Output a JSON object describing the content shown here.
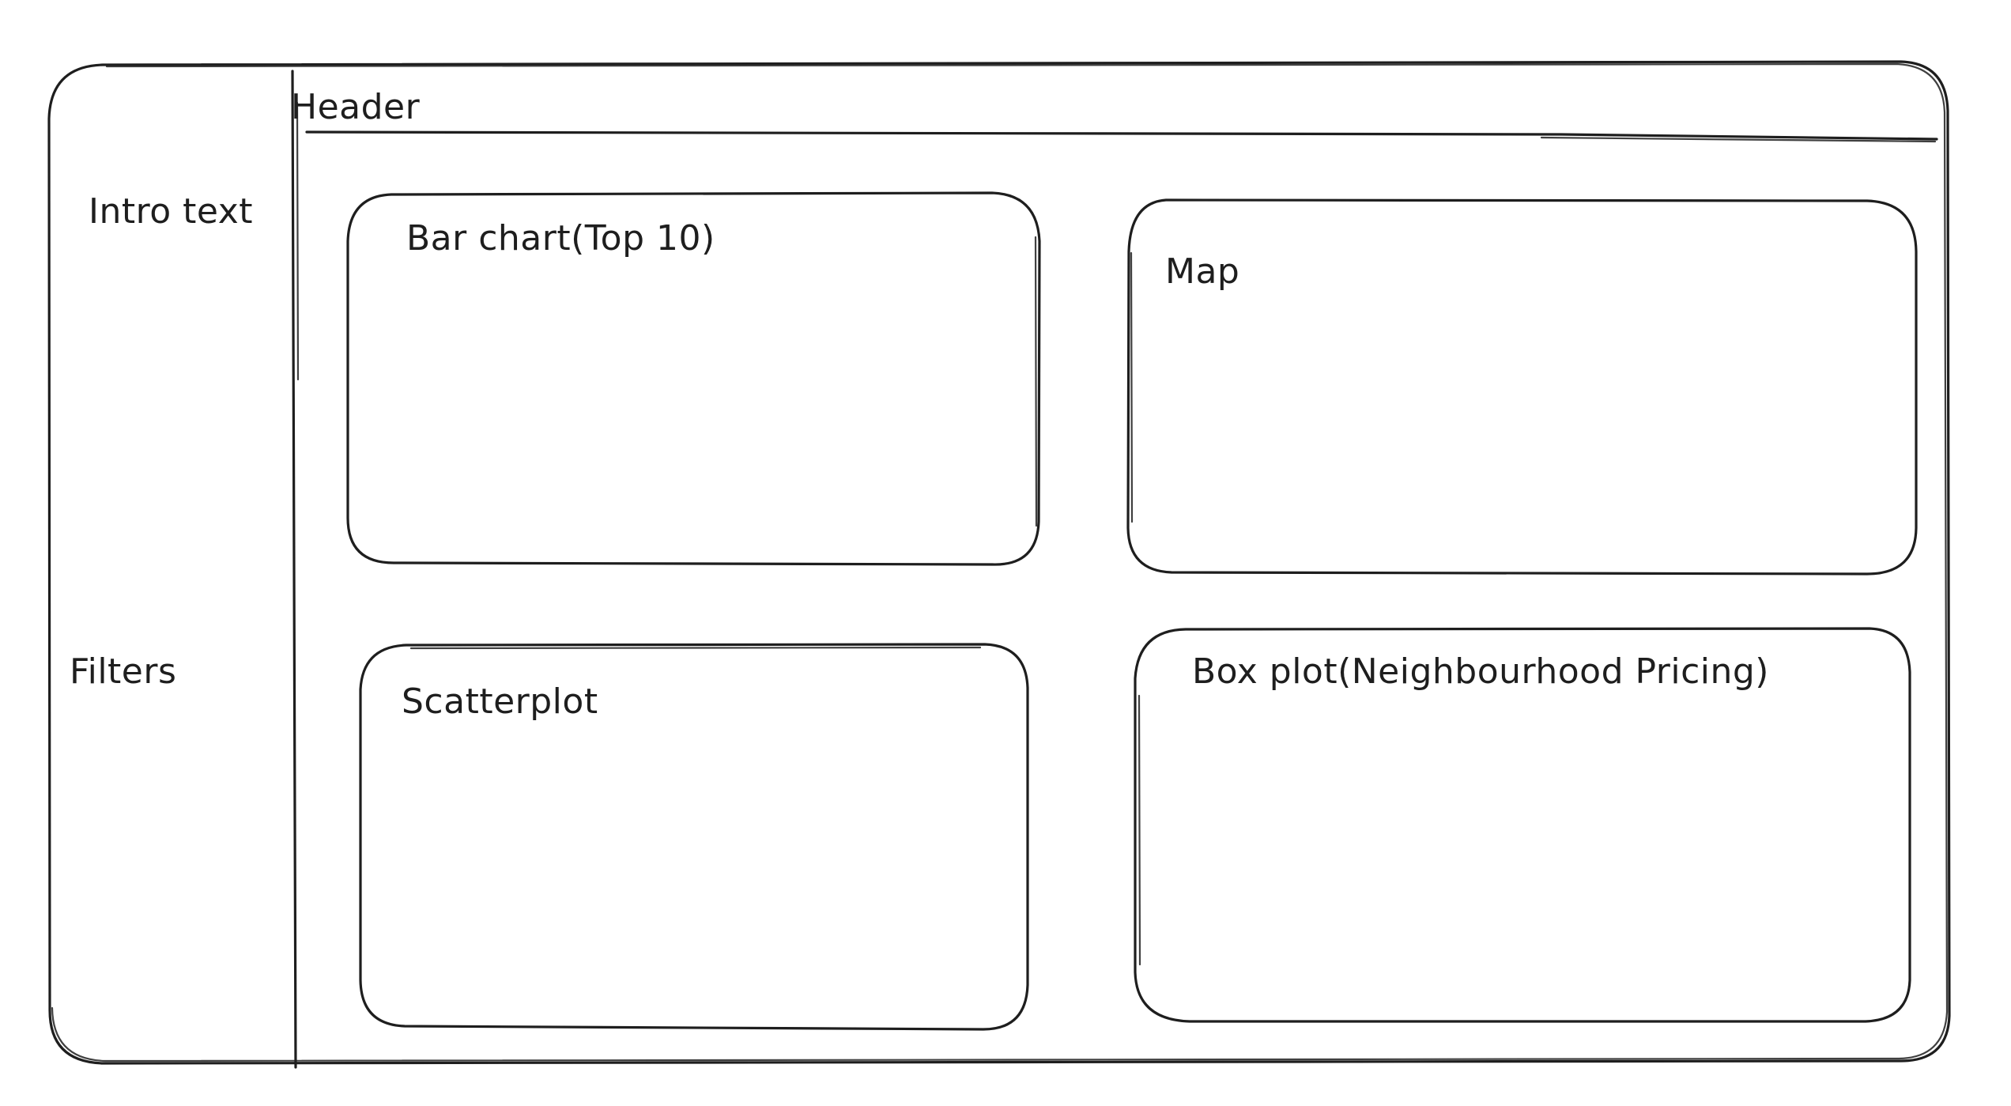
{
  "sidebar": {
    "intro_text": "Intro text",
    "filters": "Filters"
  },
  "header": {
    "title": "Header"
  },
  "panels": {
    "bar_chart": "Bar chart(Top 10)",
    "map": "Map",
    "scatterplot": "Scatterplot",
    "box_plot": "Box plot(Neighbourhood Pricing)"
  }
}
